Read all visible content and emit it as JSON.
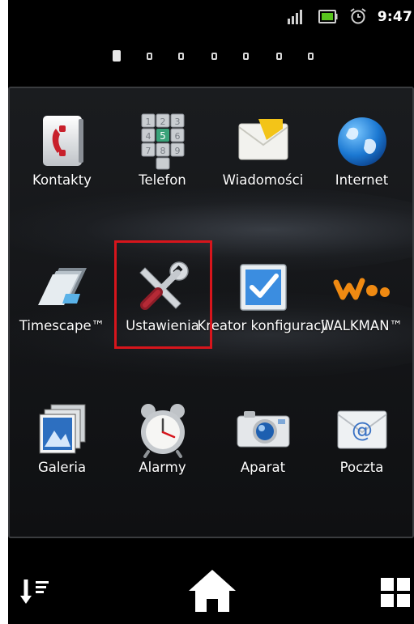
{
  "status_bar": {
    "time": "9:47",
    "icons": [
      "signal-icon",
      "battery-icon",
      "alarm-clock-icon"
    ]
  },
  "page_indicator": {
    "pages": 8,
    "current": 1
  },
  "apps": [
    {
      "label": "Kontakty",
      "icon": "contacts-icon"
    },
    {
      "label": "Telefon",
      "icon": "phone-keypad-icon"
    },
    {
      "label": "Wiadomości",
      "icon": "envelope-icon"
    },
    {
      "label": "Internet",
      "icon": "globe-icon"
    },
    {
      "label": "Timescape™",
      "icon": "timescape-icon"
    },
    {
      "label": "Ustawienia",
      "icon": "wrench-screwdriver-icon"
    },
    {
      "label": "Kreator konfiguracji",
      "icon": "checkbox-icon"
    },
    {
      "label": "WALKMAN™",
      "icon": "walkman-icon"
    },
    {
      "label": "Galeria",
      "icon": "gallery-icon"
    },
    {
      "label": "Alarmy",
      "icon": "alarm-clock-icon"
    },
    {
      "label": "Aparat",
      "icon": "camera-icon"
    },
    {
      "label": "Poczta",
      "icon": "email-icon"
    }
  ],
  "highlighted_app": "Ustawienia",
  "bottom_bar": {
    "left_icon": "sort-icon",
    "center_icon": "home-icon",
    "right_icon": "grid-icon"
  },
  "colors": {
    "highlight": "#d7151c",
    "background": "#000000"
  }
}
